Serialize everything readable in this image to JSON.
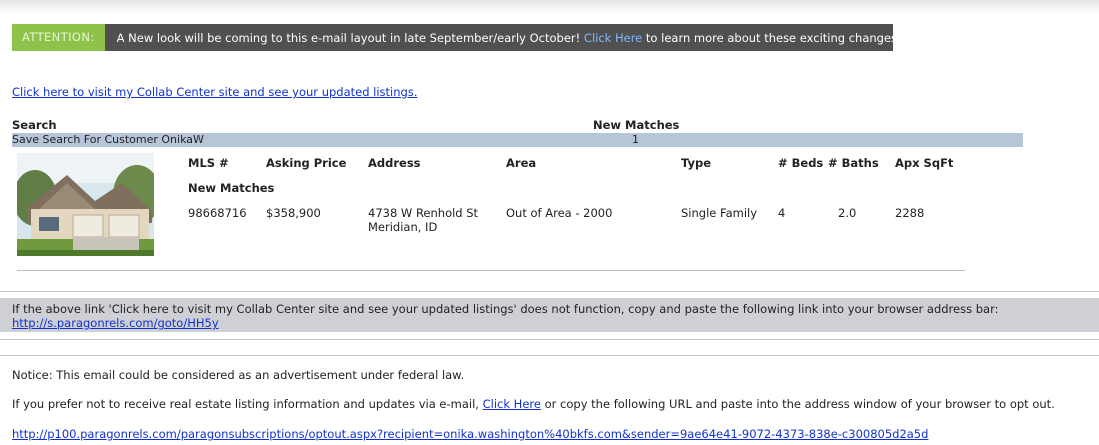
{
  "banner": {
    "tag": "ATTENTION:",
    "message": "A New look will be coming to this e-mail layout in late September/early October!",
    "link": "Click Here",
    "message_end": "to learn more about these exciting changes."
  },
  "collab_link": "Click here to visit my Collab Center site and see your updated listings.",
  "results": {
    "search_header": "Search",
    "new_matches_header": "New Matches",
    "search_name": "Save Search For Customer OnikaW",
    "new_matches_count": "1",
    "columns": [
      "MLS #",
      "Asking Price",
      "Address",
      "Area",
      "Type",
      "# Beds",
      "# Baths",
      "Apx SqFt"
    ],
    "group_label": "New Matches",
    "listing": {
      "mls": "98668716",
      "price": "$358,900",
      "address_line1": "4738 W Renhold St",
      "address_line2": "Meridian, ID",
      "area": "Out of Area - 2000",
      "type": "Single Family",
      "beds": "4",
      "baths": "2.0",
      "sqft": "2288"
    }
  },
  "fallback": {
    "text": "If the above link 'Click here to visit my Collab Center site and see your updated listings' does not function, copy and paste the following link into your browser address bar:",
    "url": "http://s.paragonrels.com/goto/HH5y"
  },
  "notice": "Notice: This email could be considered as an advertisement under federal law.",
  "optout": {
    "before": "If you prefer not to receive real estate listing information and updates via e-mail,",
    "link": "Click Here",
    "after": "or copy the following URL and paste into the address window of your browser to opt out.",
    "url": "http://p100.paragonrels.com/paragonsubscriptions/optout.aspx?recipient=onika.washington%40bkfs.com&sender=9ae64e41-9072-4373-838e-c300805d2a5d"
  },
  "colors": {
    "banner_bg": "#505050",
    "banner_tag": "#8fc24a",
    "search_bar": "#b7c5d8",
    "fallback_bg": "#cfcfd6",
    "link": "#1133cc"
  }
}
